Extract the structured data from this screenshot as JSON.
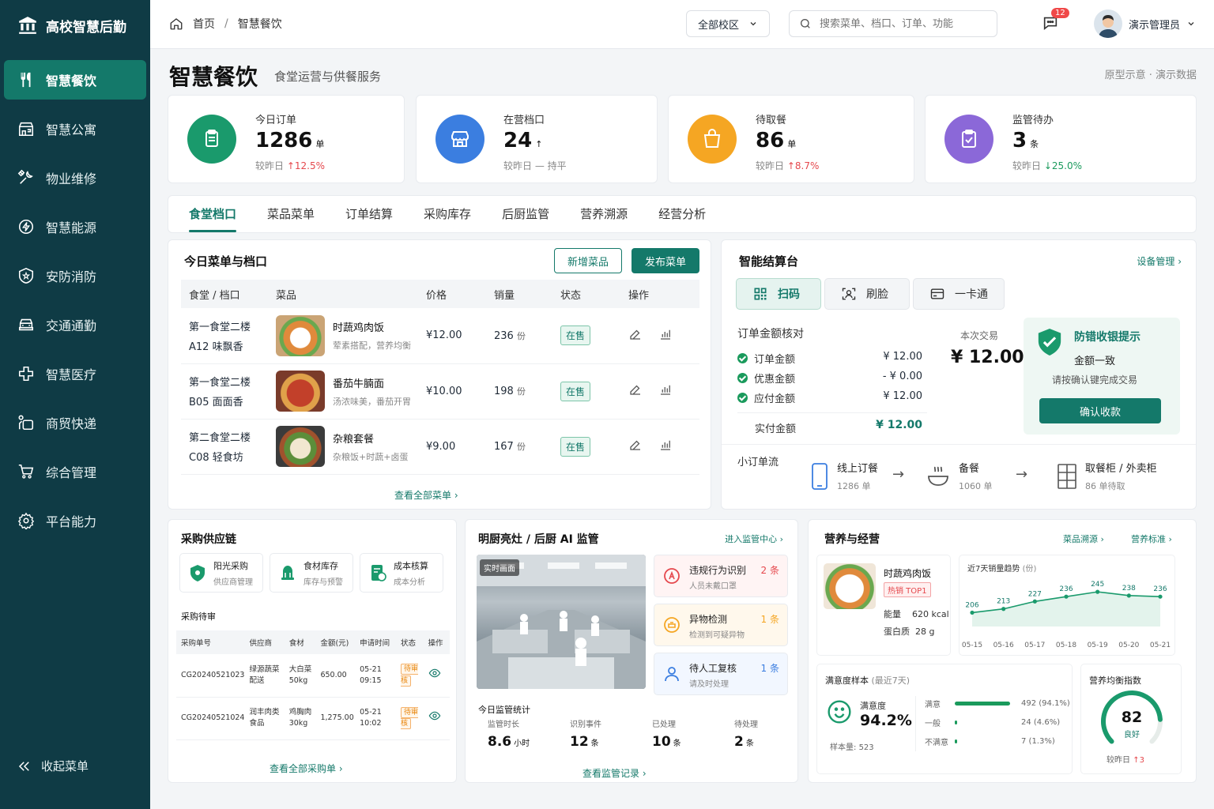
{
  "brand": {
    "title": "高校智慧后勤"
  },
  "nav": [
    {
      "label": "智慧餐饮",
      "icon": "utensils-icon",
      "active": true
    },
    {
      "label": "智慧公寓",
      "icon": "apartment-icon"
    },
    {
      "label": "物业维修",
      "icon": "tools-icon"
    },
    {
      "label": "智慧能源",
      "icon": "energy-icon"
    },
    {
      "label": "安防消防",
      "icon": "shield-icon"
    },
    {
      "label": "交通通勤",
      "icon": "car-icon"
    },
    {
      "label": "智慧医疗",
      "icon": "medical-icon"
    },
    {
      "label": "商贸快递",
      "icon": "delivery-icon"
    },
    {
      "label": "综合管理",
      "icon": "cart-icon"
    },
    {
      "label": "平台能力",
      "icon": "gear-icon"
    }
  ],
  "collapse_label": "收起菜单",
  "topbar": {
    "breadcrumb": [
      "首页",
      "智慧餐饮"
    ],
    "campus": "全部校区",
    "search_placeholder": "搜索菜单、档口、订单、功能",
    "msg_count": "12",
    "user": "演示管理员"
  },
  "page": {
    "title": "智慧餐饮",
    "subtitle": "食堂运营与供餐服务",
    "note": "原型示意 · 演示数据"
  },
  "stats": [
    {
      "label": "今日订单",
      "value": "1286",
      "unit": "单",
      "cmp_label": "较昨日",
      "cmp_value": "12.5%",
      "trend": "up",
      "color": "#1a9a6c"
    },
    {
      "label": "在营档口",
      "value": "24",
      "unit": "",
      "cmp_label": "较昨日",
      "cmp_value": "持平",
      "trend": "flat",
      "color": "#3b7ee0"
    },
    {
      "label": "待取餐",
      "value": "86",
      "unit": "单",
      "cmp_label": "较昨日",
      "cmp_value": "8.7%",
      "trend": "up",
      "color": "#f5a623"
    },
    {
      "label": "监管待办",
      "value": "3",
      "unit": "条",
      "cmp_label": "较昨日",
      "cmp_value": "25.0%",
      "trend": "down",
      "color": "#8b68d8"
    }
  ],
  "tabs": [
    "食堂档口",
    "菜品菜单",
    "订单结算",
    "采购库存",
    "后厨监管",
    "营养溯源",
    "经营分析"
  ],
  "menu": {
    "title": "今日菜单与档口",
    "add_btn": "新增菜品",
    "publish_btn": "发布菜单",
    "headers": [
      "食堂 / 档口",
      "菜品",
      "价格",
      "销量",
      "状态",
      "操作"
    ],
    "rows": [
      {
        "canteen": "第一食堂二楼",
        "stall": "A12 味飘香",
        "dish": "时蔬鸡肉饭",
        "desc": "荤素搭配，营养均衡",
        "price": "¥12.00",
        "sales": "236",
        "status": "在售"
      },
      {
        "canteen": "第一食堂二楼",
        "stall": "B05 面面香",
        "dish": "番茄牛腩面",
        "desc": "汤浓味美，番茄开胃",
        "price": "¥10.00",
        "sales": "198",
        "status": "在售"
      },
      {
        "canteen": "第二食堂二楼",
        "stall": "C08 轻食坊",
        "dish": "杂粮套餐",
        "desc": "杂粮饭+时蔬+卤蛋",
        "price": "¥9.00",
        "sales": "167",
        "status": "在售"
      }
    ],
    "unit": "份",
    "view_all": "查看全部菜单"
  },
  "pay": {
    "title": "智能结算台",
    "device_link": "设备管理",
    "methods": [
      "扫码",
      "刷脸",
      "一卡通"
    ],
    "check_title": "订单金额核对",
    "trade_label": "本次交易",
    "trade_value": "¥ 12.00",
    "items": [
      {
        "label": "订单金额",
        "value": "¥ 12.00"
      },
      {
        "label": "优惠金额",
        "value": "- ¥ 0.00"
      },
      {
        "label": "应付金额",
        "value": "¥ 12.00"
      }
    ],
    "paid_label": "实付金额",
    "paid_value": "¥ 12.00",
    "guard_title": "防错收银提示",
    "guard_status": "金额一致",
    "guard_hint": "请按确认键完成交易",
    "confirm_btn": "确认收款",
    "flow_title": "小订单流",
    "flow": [
      {
        "t1": "线上订餐",
        "t2": "1286 单"
      },
      {
        "t1": "备餐",
        "t2": "1060 单"
      },
      {
        "t1": "取餐柜 / 外卖柜",
        "t2": "86 单待取"
      }
    ]
  },
  "purchase": {
    "title": "采购供应链",
    "tiles": [
      {
        "a": "阳光采购",
        "b": "供应商管理"
      },
      {
        "a": "食材库存",
        "b": "库存与预警"
      },
      {
        "a": "成本核算",
        "b": "成本分析"
      }
    ],
    "pending_title": "采购待审",
    "headers": [
      "采购单号",
      "供应商",
      "食材",
      "金额(元)",
      "申请时间",
      "状态",
      "操作"
    ],
    "rows": [
      {
        "no": "CG20240521023",
        "supplier": "绿源蔬菜配送",
        "item": "大白菜 50kg",
        "amount": "650.00",
        "time": "05-21 09:15",
        "status": "待审核"
      },
      {
        "no": "CG20240521024",
        "supplier": "润丰肉类食品",
        "item": "鸡胸肉 30kg",
        "amount": "1,275.00",
        "time": "05-21 10:02",
        "status": "待审核"
      }
    ],
    "view_all": "查看全部采购单"
  },
  "monitor": {
    "title": "明厨亮灶 / 后厨 AI 监管",
    "link": "进入监管中心",
    "live_tag": "实时画面",
    "alerts": [
      {
        "t": "违规行为识别",
        "d": "人员未戴口罩",
        "c": "2 条",
        "color": "#e5484d"
      },
      {
        "t": "异物检测",
        "d": "检测到可疑异物",
        "c": "1 条",
        "color": "#f5a623"
      },
      {
        "t": "待人工复核",
        "d": "请及时处理",
        "c": "1 条",
        "color": "#3b7ee0"
      }
    ],
    "stats_title": "今日监管统计",
    "stats": [
      {
        "l": "监管时长",
        "v": "8.6",
        "u": "小时"
      },
      {
        "l": "识别事件",
        "v": "12",
        "u": "条"
      },
      {
        "l": "已处理",
        "v": "10",
        "u": "条"
      },
      {
        "l": "待处理",
        "v": "2",
        "u": "条"
      }
    ],
    "view_all": "查看监管记录"
  },
  "nutrition": {
    "title": "营养与经营",
    "link1": "菜品溯源",
    "link2": "营养标准",
    "dish": "时蔬鸡肉饭",
    "hot_tag": "热销 TOP1",
    "energy_label": "能量",
    "energy": "620 kcal",
    "protein_label": "蛋白质",
    "protein": "28 g",
    "satisfaction_title": "满意度样本",
    "satisfaction_range": "(最近7天)",
    "sat_label": "满意度",
    "sat_value": "94.2%",
    "sample_label": "样本量:",
    "sample": "523",
    "bars": [
      {
        "l": "满意",
        "v": "492 (94.1%)",
        "frac": 0.941
      },
      {
        "l": "一般",
        "v": "24 (4.6%)",
        "frac": 0.046
      },
      {
        "l": "不满意",
        "v": "7 (1.3%)",
        "frac": 0.013
      }
    ],
    "index_title": "营养均衡指数",
    "index_value": "82",
    "index_frac": 0.82,
    "index_level": "良好",
    "index_cmp_label": "较昨日",
    "index_cmp": "3"
  },
  "chart_data": {
    "type": "line",
    "title": "近7天销量趋势",
    "unit": "(份)",
    "categories": [
      "05-15",
      "05-16",
      "05-17",
      "05-18",
      "05-19",
      "05-20",
      "05-21"
    ],
    "values": [
      206,
      213,
      227,
      236,
      245,
      238,
      236
    ],
    "ylim": [
      180,
      260
    ]
  }
}
